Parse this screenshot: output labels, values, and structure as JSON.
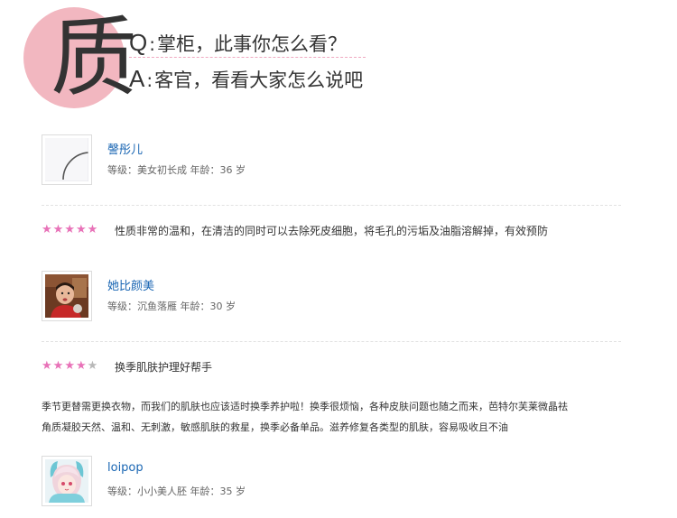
{
  "header": {
    "badge_char": "质",
    "q_letter": "Q",
    "q_colon": ":",
    "q_text": "掌柜，此事你怎么看？",
    "a_letter": "A",
    "a_colon": ":",
    "a_text": "客官，看看大家怎么说吧"
  },
  "reviews": [
    {
      "name": "謦彤儿",
      "level_label": "等级：",
      "level": "美女初长成",
      "age_label": "年龄：",
      "age": "36",
      "age_unit": "岁",
      "rating": 5,
      "rating_max": 5,
      "text": "性质非常的温和，在清洁的同时可以去除死皮细胞，将毛孔的污垢及油脂溶解掉，有效预防"
    },
    {
      "name": "她比颜美",
      "level_label": "等级：",
      "level": "沉鱼落雁",
      "age_label": "年龄：",
      "age": "30",
      "age_unit": "岁",
      "rating": 4,
      "rating_max": 5,
      "text": "换季肌肤护理好帮手",
      "body_line1": "季节更替需更换衣物，而我们的肌肤也应该适时换季养护啦！换季很烦恼，各种皮肤问题也随之而来，芭特尔芙莱微晶祛",
      "body_line2": "角质凝胶天然、温和、无刺激，敏感肌肤的救星，换季必备单品。滋养修复各类型的肌肤，容易吸收且不油"
    },
    {
      "name": "loipop",
      "level_label": "等级：",
      "level": "小小美人胚",
      "age_label": "年龄：",
      "age": "35",
      "age_unit": "岁"
    }
  ],
  "icons": {
    "star": "★"
  },
  "colors": {
    "badge": "#f2b7c0",
    "star_on": "#e872b8",
    "star_off": "#b8b8b8",
    "username": "#1a66b3"
  }
}
